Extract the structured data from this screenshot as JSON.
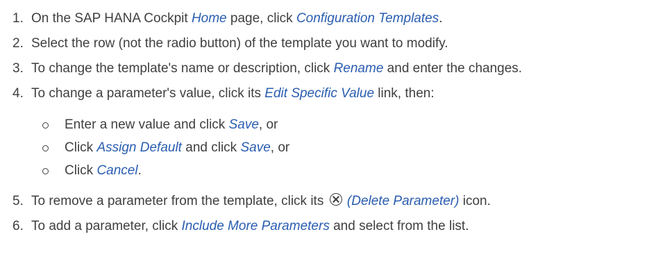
{
  "steps": [
    {
      "num": "1.",
      "t1": "On the SAP HANA Cockpit ",
      "l1": "Home",
      "t2": " page, click ",
      "l2": "Configuration Templates",
      "t3": "."
    },
    {
      "num": "2.",
      "t1": "Select the row (not the radio button) of the template you want to modify."
    },
    {
      "num": "3.",
      "t1": "To change the template's name or description, click ",
      "l1": "Rename",
      "t2": " and enter the changes."
    },
    {
      "num": "4.",
      "t1": "To change a parameter's value, click its ",
      "l1": "Edit Specific Value",
      "t2": " link, then:",
      "sub": [
        {
          "t1": "Enter a new value and click ",
          "l1": "Save",
          "t2": ", or"
        },
        {
          "t1": "Click ",
          "l1": "Assign Default",
          "t2": " and click ",
          "l2": "Save",
          "t3": ", or"
        },
        {
          "t1": "Click ",
          "l1": "Cancel",
          "t2": "."
        }
      ]
    },
    {
      "num": "5.",
      "t1": "To remove a parameter from the template, click its ",
      "icon": "delete-parameter-icon",
      "l1": "(Delete Parameter)",
      "t2": " icon."
    },
    {
      "num": "6.",
      "t1": "To add a parameter, click ",
      "l1": "Include More Parameters",
      "t2": " and select from the list."
    }
  ]
}
